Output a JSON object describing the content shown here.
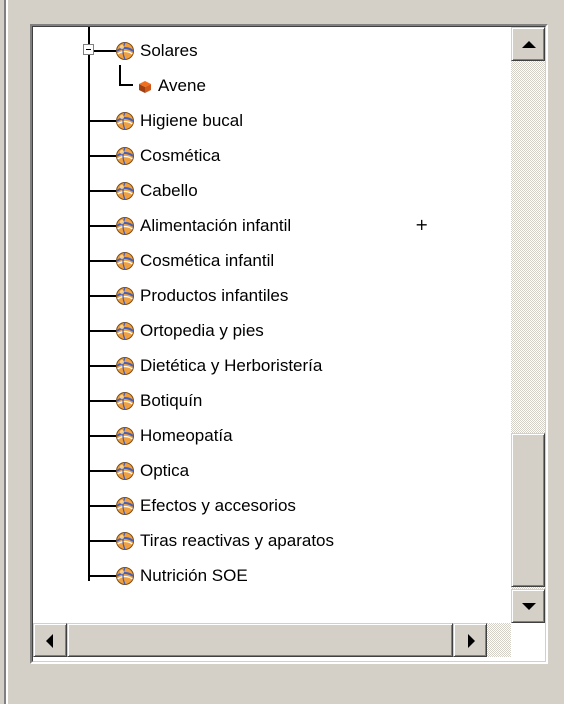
{
  "tree": {
    "items": [
      {
        "label": "Solares",
        "level": 0,
        "expanded": true,
        "icon": "category-globe-icon"
      },
      {
        "label": "Avene",
        "level": 1,
        "icon": "brand-product-icon"
      },
      {
        "label": "Higiene bucal",
        "level": 0,
        "icon": "category-globe-icon"
      },
      {
        "label": "Cosmética",
        "level": 0,
        "icon": "category-globe-icon"
      },
      {
        "label": "Cabello",
        "level": 0,
        "icon": "category-globe-icon"
      },
      {
        "label": "Alimentación infantil",
        "level": 0,
        "icon": "category-globe-icon"
      },
      {
        "label": "Cosmética infantil",
        "level": 0,
        "icon": "category-globe-icon"
      },
      {
        "label": "Productos infantiles",
        "level": 0,
        "icon": "category-globe-icon"
      },
      {
        "label": "Ortopedia y pies",
        "level": 0,
        "icon": "category-globe-icon"
      },
      {
        "label": "Dietética y Herboristería",
        "level": 0,
        "icon": "category-globe-icon"
      },
      {
        "label": "Botiquín",
        "level": 0,
        "icon": "category-globe-icon"
      },
      {
        "label": "Homeopatía",
        "level": 0,
        "icon": "category-globe-icon"
      },
      {
        "label": "Optica",
        "level": 0,
        "icon": "category-globe-icon"
      },
      {
        "label": "Efectos y accesorios",
        "level": 0,
        "icon": "category-globe-icon"
      },
      {
        "label": "Tiras reactivas y aparatos",
        "level": 0,
        "icon": "category-globe-icon"
      },
      {
        "label": "Nutrición SOE",
        "level": 0,
        "icon": "category-globe-icon"
      }
    ],
    "cursor_mark": "+"
  },
  "scrollbars": {
    "vertical_position": 0.85,
    "horizontal_position": 0.0
  },
  "colors": {
    "window_bg": "#d4d0c8",
    "tree_bg": "#ffffff",
    "globe_orange": "#f0a040",
    "globe_blue": "#4060c0"
  }
}
